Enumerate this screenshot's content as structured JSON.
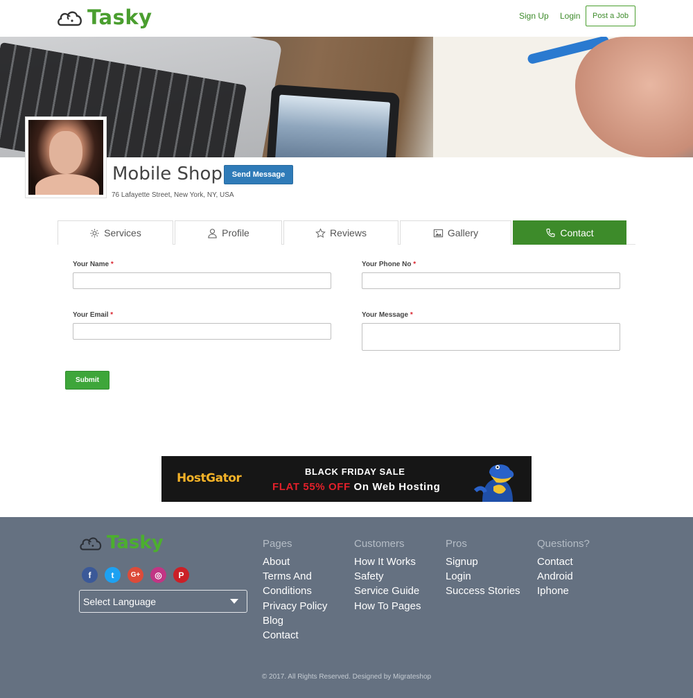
{
  "header": {
    "logo_text": "Tasky",
    "nav": {
      "signup": "Sign Up",
      "login": "Login",
      "post_job": "Post a Job"
    }
  },
  "profile": {
    "name": "Mobile Shop",
    "send_message": "Send Message",
    "address": "76 Lafayette Street, New York, NY, USA"
  },
  "tabs": [
    {
      "label": "Services",
      "icon": "gear-icon"
    },
    {
      "label": "Profile",
      "icon": "user-icon"
    },
    {
      "label": "Reviews",
      "icon": "star-icon"
    },
    {
      "label": "Gallery",
      "icon": "image-icon"
    },
    {
      "label": "Contact",
      "icon": "phone-icon",
      "active": true
    }
  ],
  "form": {
    "name_label": "Your Name",
    "phone_label": "Your Phone No",
    "email_label": "Your Email",
    "message_label": "Your Message",
    "required_mark": "*",
    "name_value": "",
    "phone_value": "",
    "email_value": "",
    "message_value": "",
    "submit": "Submit"
  },
  "banner": {
    "brand": "HostGator",
    "title": "BLACK FRIDAY SALE",
    "offer_highlight": "FLAT 55% OFF",
    "offer_rest": "On Web Hosting"
  },
  "footer": {
    "logo_text": "Tasky",
    "socials": [
      {
        "name": "facebook",
        "glyph": "f",
        "color": "#3b5998"
      },
      {
        "name": "twitter",
        "glyph": "t",
        "color": "#1da1f2"
      },
      {
        "name": "google-plus",
        "glyph": "G+",
        "color": "#dd4b39"
      },
      {
        "name": "instagram",
        "glyph": "◎",
        "color": "#c13584"
      },
      {
        "name": "pinterest",
        "glyph": "P",
        "color": "#cb2027"
      }
    ],
    "language_select": "Select Language",
    "columns": [
      {
        "heading": "Pages",
        "links": [
          "About",
          "Terms And Conditions",
          "Privacy Policy",
          "Blog",
          "Contact"
        ]
      },
      {
        "heading": "Customers",
        "links": [
          "How It Works",
          "Safety",
          "Service Guide",
          "How To Pages"
        ]
      },
      {
        "heading": "Pros",
        "links": [
          "Signup",
          "Login",
          "Success Stories"
        ]
      },
      {
        "heading": "Questions?",
        "links": [
          "Contact",
          "Android",
          "Iphone"
        ]
      }
    ],
    "copyright": "© 2017. All Rights Reserved. Designed by Migrateshop"
  },
  "colors": {
    "brand_green": "#3d8b2a",
    "footer_bg": "#657181",
    "send_blue": "#2f7bb8"
  }
}
